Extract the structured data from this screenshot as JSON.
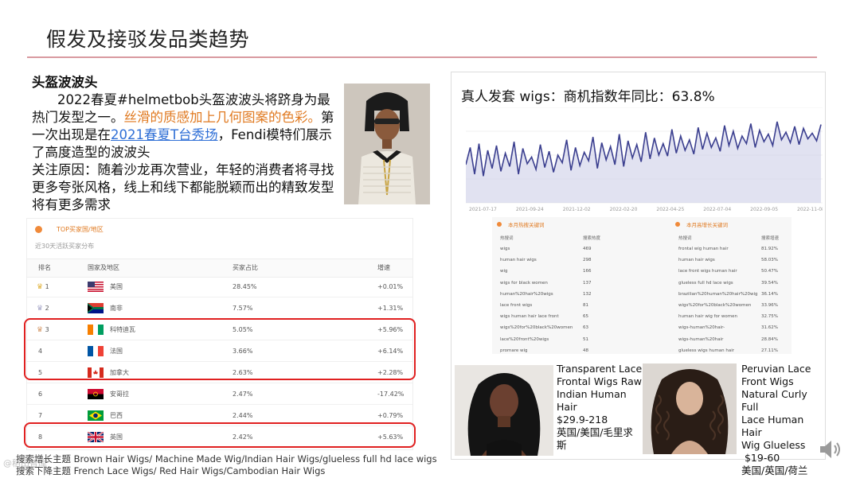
{
  "slide": {
    "title": "假发及接驳发品类趋势"
  },
  "left_text": {
    "heading": "头盔波波头",
    "p1_a": "2022春夏#helmetbob头盔波波头将跻身为最热门发型之一。",
    "p1_orange": "丝滑的质感加上几何图案的色彩。",
    "p1_b": "第一次出现是在",
    "p1_link": "2021春夏T台秀场",
    "p1_c": "，Fendi模特们展示了高度造型的波波头",
    "p2": "关注原因：随着沙龙再次营业，年轻的消费者将寻找更多夸张风格，线上和线下都能脱颖而出的精致发型将有更多需求"
  },
  "region_table": {
    "title": "TOP买家国/地区",
    "subtitle": "近30天活跃买家分布",
    "headers": {
      "rank": "排名",
      "country": "国家及地区",
      "share": "买家占比",
      "growth": "增速"
    },
    "rows": [
      {
        "rank": "1",
        "flag": "usa-flag",
        "country": "美国",
        "share": "28.45%",
        "growth": "+0.01%"
      },
      {
        "rank": "2",
        "flag": "south-africa-flag",
        "country": "南非",
        "share": "7.57%",
        "growth": "+1.31%"
      },
      {
        "rank": "3",
        "flag": "ivory-coast-flag",
        "country": "科特迪瓦",
        "share": "5.05%",
        "growth": "+5.96%"
      },
      {
        "rank": "4",
        "flag": "france-flag",
        "country": "法国",
        "share": "3.66%",
        "growth": "+6.14%"
      },
      {
        "rank": "5",
        "flag": "canada-flag",
        "country": "加拿大",
        "share": "2.63%",
        "growth": "+2.28%"
      },
      {
        "rank": "6",
        "flag": "angola-flag",
        "country": "安哥拉",
        "share": "2.47%",
        "growth": "-17.42%"
      },
      {
        "rank": "7",
        "flag": "brazil-flag",
        "country": "巴西",
        "share": "2.44%",
        "growth": "+0.79%"
      },
      {
        "rank": "8",
        "flag": "uk-flag",
        "country": "英国",
        "share": "2.42%",
        "growth": "+5.63%"
      }
    ]
  },
  "notes": {
    "line1": "搜索增长主题 Brown Hair Wigs/ Machine Made Wig/Indian Hair Wigs/glueless full hd lace wigs",
    "line2": "搜索下降主题 French Lace Wigs/ Red Hair Wigs/Cambodian Hair Wigs"
  },
  "watermark": "@稻田智库",
  "right_panel": {
    "chart_title": "真人发套 wigs：商机指数年同比：63.8%",
    "chart_data": {
      "type": "area",
      "x_ticks": [
        "2021-07-17",
        "2021-09-24",
        "2021-12-02",
        "2022-02-20",
        "2022-04-25",
        "2022-07-04",
        "2022-09-05",
        "2022-11-08"
      ],
      "series": [
        {
          "values": [
            40,
            58,
            30,
            62,
            28,
            55,
            36,
            60,
            33,
            52,
            38,
            64,
            30,
            57,
            41,
            48,
            35,
            61,
            37,
            54,
            32,
            50,
            42,
            66,
            34,
            58,
            39,
            53,
            44,
            69,
            36,
            63,
            45,
            59,
            40,
            72,
            38,
            65,
            47,
            61,
            43,
            74,
            46,
            68,
            50,
            62,
            49,
            77,
            52,
            70,
            55,
            66,
            51,
            79,
            56,
            73,
            58,
            68,
            54,
            81,
            60,
            75,
            57,
            70,
            62,
            83,
            58,
            76,
            64,
            72,
            60,
            85,
            66,
            74,
            63,
            80,
            61,
            78,
            67,
            73,
            65,
            82
          ],
          "color": "#3b3f8f"
        }
      ],
      "ylim": [
        0,
        100
      ],
      "grid": true
    },
    "keywords_left": {
      "title": "本月热搜关键词",
      "col1": "热搜词",
      "col2": "搜索热度",
      "rows": [
        {
          "term": "wigs",
          "value": "469"
        },
        {
          "term": "human hair wigs",
          "value": "298"
        },
        {
          "term": "wig",
          "value": "166"
        },
        {
          "term": "wigs for black women",
          "value": "137"
        },
        {
          "term": "human%20hair%20wigs",
          "value": "132"
        },
        {
          "term": "lace front wigs",
          "value": "81"
        },
        {
          "term": "wigs human hair lace front",
          "value": "65"
        },
        {
          "term": "wigs%20for%20black%20women",
          "value": "63"
        },
        {
          "term": "lace%20front%20wigs",
          "value": "51"
        },
        {
          "term": "promare wig",
          "value": "48"
        }
      ]
    },
    "keywords_right": {
      "title": "本月高增长关键词",
      "col1": "热搜词",
      "col2": "搜索增速",
      "rows": [
        {
          "term": "frontal wig human hair",
          "value": "81.92%"
        },
        {
          "term": "human hair wigs",
          "value": "58.03%"
        },
        {
          "term": "lace front wigs human hair",
          "value": "50.47%"
        },
        {
          "term": "glueless full hd lace wigs",
          "value": "39.54%"
        },
        {
          "term": "brazilian%20human%20hair%20wig",
          "value": "36.14%"
        },
        {
          "term": "wigs%20for%20black%20women",
          "value": "33.96%"
        },
        {
          "term": "human hair wig for women",
          "value": "32.75%"
        },
        {
          "term": "wigs-human%20hair-",
          "value": "31.62%"
        },
        {
          "term": "wigs-human%20hair",
          "value": "28.84%"
        },
        {
          "term": "glueless wigs human hair",
          "value": "27.11%"
        }
      ]
    },
    "product1": {
      "lines": [
        "Transparent Lace",
        "Frontal Wigs Raw",
        "Indian Human",
        "Hair",
        "$29.9-218",
        "英国/美国/毛里求",
        "斯"
      ]
    },
    "product2": {
      "lines": [
        "Peruvian Lace",
        "Front Wigs",
        "Natural Curly Full",
        "Lace Human Hair",
        "Wig Glueless",
        " $19-60",
        "美国/英国/荷兰"
      ]
    }
  }
}
